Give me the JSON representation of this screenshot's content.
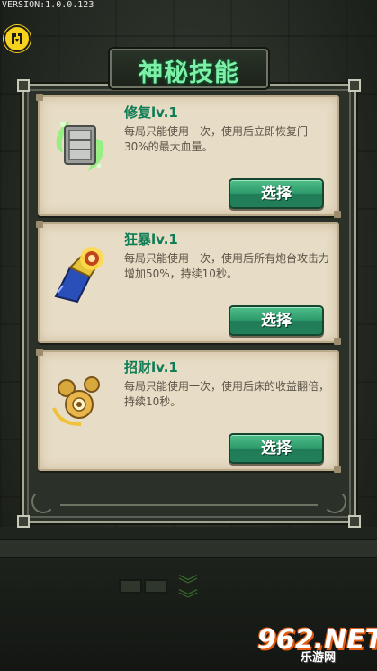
{
  "version": "VERSION:1.0.0.123",
  "title": "神秘技能",
  "skills": [
    {
      "name": "修复lv.1",
      "description": "每局只能使用一次，使用后立即恢复门30%的最大血量。",
      "button": "选择",
      "icon": "repair-door-icon"
    },
    {
      "name": "狂暴lv.1",
      "description": "每局只能使用一次，使用后所有炮台攻击力增加50%，持续10秒。",
      "button": "选择",
      "icon": "berserk-cannon-icon"
    },
    {
      "name": "招财lv.1",
      "description": "每局只能使用一次，使用后床的收益翻倍，持续10秒。",
      "button": "选择",
      "icon": "fortune-coins-icon"
    }
  ],
  "watermark": {
    "logo": "962.NET",
    "sub": "乐游网"
  },
  "colors": {
    "title": "#7df0a8",
    "skill_name": "#0e7c55",
    "button": "#2f9a6c",
    "card": "#e7dcc5"
  }
}
